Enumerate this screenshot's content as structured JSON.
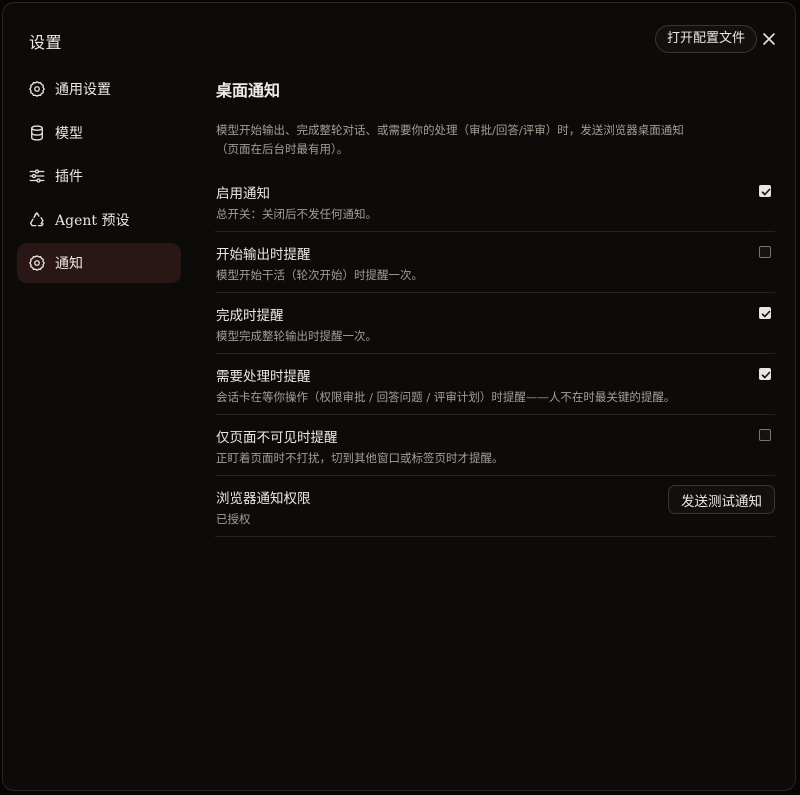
{
  "window": {
    "title": "设置",
    "open_config_label": "打开配置文件"
  },
  "sidebar": {
    "items": [
      {
        "label": "通用设置",
        "icon": "gear-icon",
        "active": false
      },
      {
        "label": "模型",
        "icon": "database-icon",
        "active": false
      },
      {
        "label": "插件",
        "icon": "sliders-icon",
        "active": false
      },
      {
        "label": "Agent 预设",
        "icon": "recycle-icon",
        "active": false
      },
      {
        "label": "通知",
        "icon": "gear-icon",
        "active": true
      }
    ]
  },
  "main": {
    "heading": "桌面通知",
    "description": "模型开始输出、完成整轮对话、或需要你的处理（审批/回答/评审）时，发送浏览器桌面通知（页面在后台时最有用）。",
    "settings": [
      {
        "label": "启用通知",
        "sub": "总开关：关闭后不发任何通知。",
        "checked": true
      },
      {
        "label": "开始输出时提醒",
        "sub": "模型开始干活（轮次开始）时提醒一次。",
        "checked": false
      },
      {
        "label": "完成时提醒",
        "sub": "模型完成整轮输出时提醒一次。",
        "checked": true
      },
      {
        "label": "需要处理时提醒",
        "sub": "会话卡在等你操作（权限审批 / 回答问题 / 评审计划）时提醒——人不在时最关键的提醒。",
        "checked": true
      },
      {
        "label": "仅页面不可见时提醒",
        "sub": "正盯着页面时不打扰，切到其他窗口或标签页时才提醒。",
        "checked": false
      }
    ],
    "permission": {
      "label": "浏览器通知权限",
      "status": "已授权",
      "test_button_label": "发送测试通知"
    }
  },
  "colors": {
    "active_nav_bg": "#2b1616",
    "background": "#0c0b0a"
  }
}
